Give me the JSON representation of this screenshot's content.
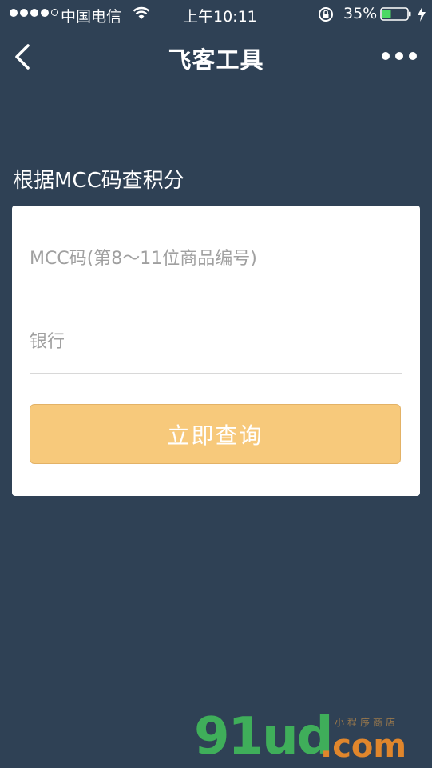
{
  "status_bar": {
    "carrier": "中国电信",
    "time": "上午10:11",
    "battery_percent": "35%",
    "battery_level": 0.35,
    "signal_bars_filled": 4,
    "signal_bars_total": 5
  },
  "nav": {
    "title": "飞客工具",
    "back_icon": "chevron-left-icon",
    "more_icon": "more-dots-icon"
  },
  "section": {
    "heading": "根据MCC码查积分"
  },
  "form": {
    "mcc_placeholder": "MCC码(第8～11位商品编号)",
    "mcc_value": "",
    "bank_placeholder": "银行",
    "bank_value": "",
    "submit_label": "立即查询"
  },
  "watermark": {
    "main": "91ud",
    "suffix": ".com",
    "small": "小程序商店"
  },
  "colors": {
    "background": "#2f4155",
    "card": "#ffffff",
    "button": "#f7c97b",
    "watermark_green": "#3fae5a",
    "watermark_orange": "#e0862c"
  }
}
